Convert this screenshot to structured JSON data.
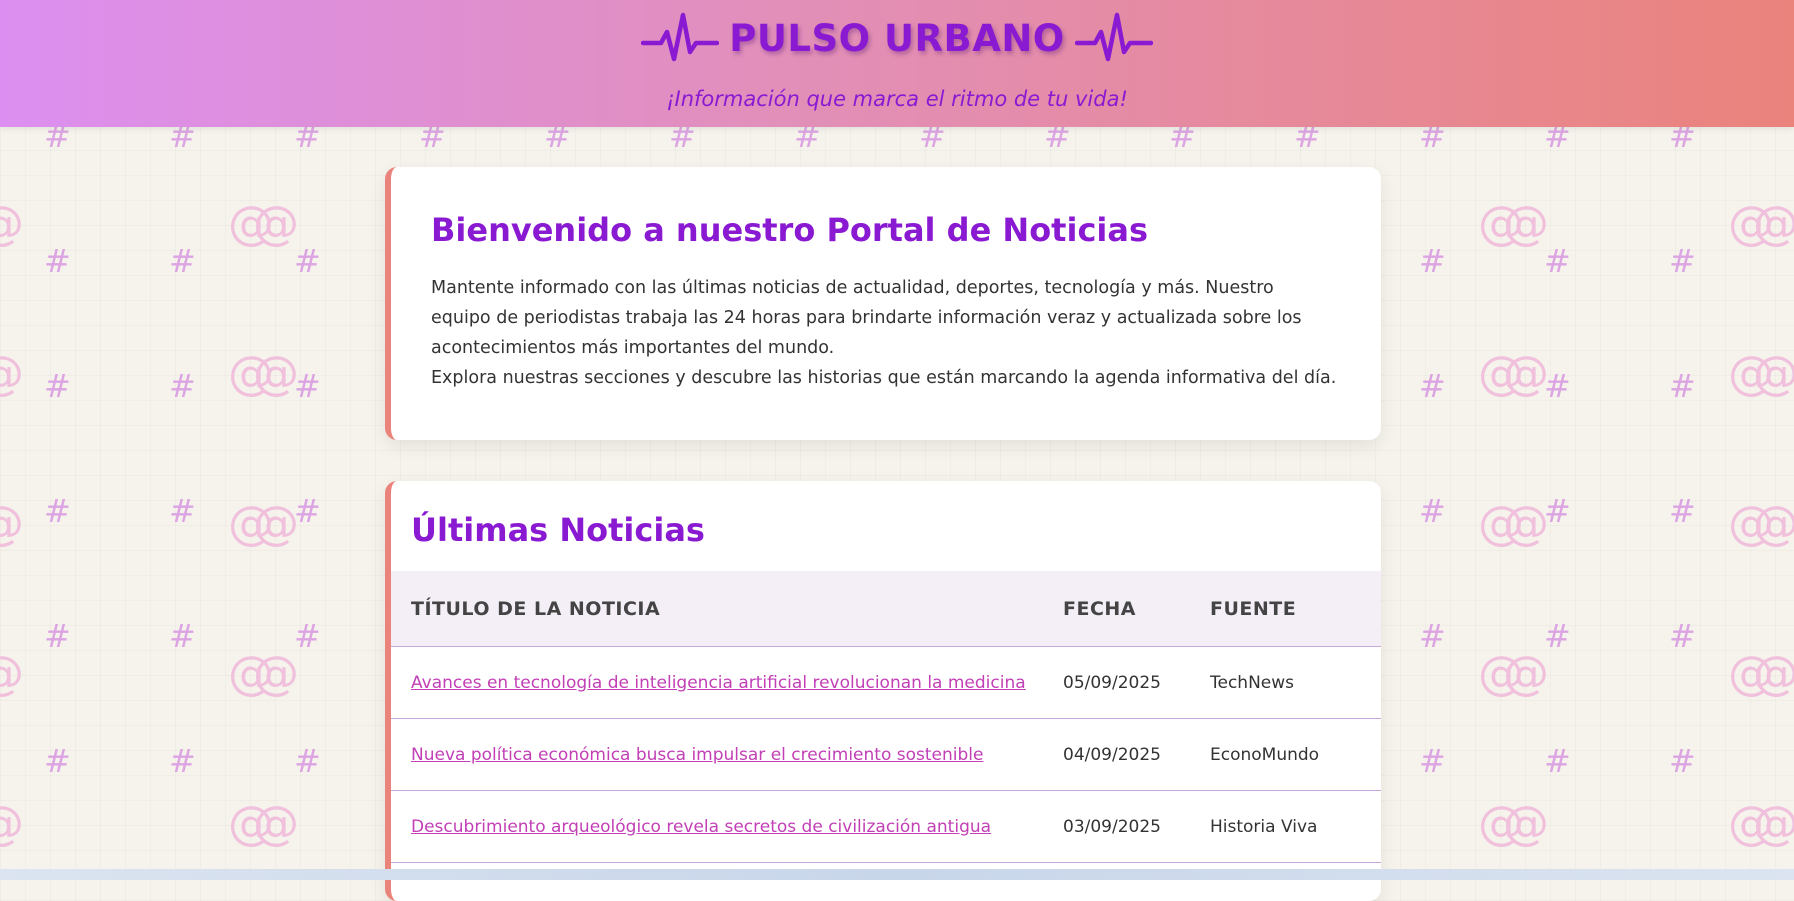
{
  "header": {
    "title": "PULSO URBANO",
    "tagline": "¡Información que marca el ritmo de tu vida!"
  },
  "welcome": {
    "heading": "Bienvenido a nuestro Portal de Noticias",
    "paragraph1": "Mantente informado con las últimas noticias de actualidad, deportes, tecnología y más. Nuestro equipo de periodistas trabaja las 24 horas para brindarte información veraz y actualizada sobre los acontecimientos más importantes del mundo.",
    "paragraph2": "Explora nuestras secciones y descubre las historias que están marcando la agenda informativa del día."
  },
  "news": {
    "heading": "Últimas Noticias",
    "columns": [
      "TÍTULO DE LA NOTICIA",
      "FECHA",
      "FUENTE"
    ],
    "rows": [
      {
        "title": "Avances en tecnología de inteligencia artificial revolucionan la medicina",
        "date": "05/09/2025",
        "source": "TechNews"
      },
      {
        "title": "Nueva política económica busca impulsar el crecimiento sostenible",
        "date": "04/09/2025",
        "source": "EconoMundo"
      },
      {
        "title": "Descubrimiento arqueológico revela secretos de civilización antigua",
        "date": "03/09/2025",
        "source": "Historia Viva"
      }
    ]
  },
  "background": {
    "symbols": [
      "#",
      "@"
    ]
  },
  "colors": {
    "brand": "#8a1ad2",
    "link": "#c23fb6",
    "accent": "#ea837c",
    "header_gradient_start": "#dc8ff0",
    "header_gradient_end": "#ea837c"
  }
}
